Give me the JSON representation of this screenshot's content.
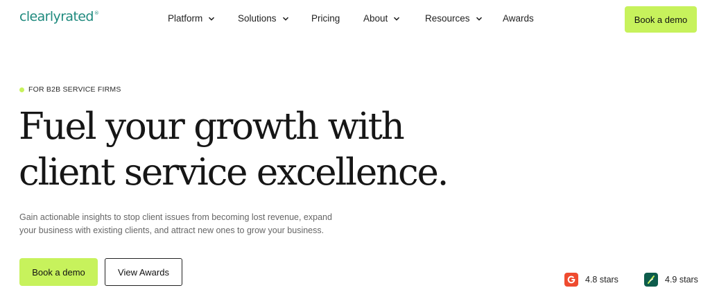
{
  "nav": {
    "logo": {
      "text": "clearlyrated",
      "mark": "®"
    },
    "items": [
      {
        "label": "Platform",
        "has_dropdown": true
      },
      {
        "label": "Solutions",
        "has_dropdown": true
      },
      {
        "label": "Pricing",
        "has_dropdown": false
      },
      {
        "label": "About",
        "has_dropdown": true
      },
      {
        "label": "Resources",
        "has_dropdown": true
      },
      {
        "label": "Awards",
        "has_dropdown": false
      }
    ],
    "cta_label": "Book a demo"
  },
  "hero": {
    "eyebrow": "FOR B2B SERVICE FIRMS",
    "headline_line1": "Fuel your growth with",
    "headline_line2": "client service excellence.",
    "subtext": "Gain actionable insights to stop client issues from becoming lost revenue, expand your business with existing clients, and attract new ones to grow your business.",
    "primary_cta": "Book a demo",
    "secondary_cta": "View Awards"
  },
  "ratings": [
    {
      "icon": "g2-icon",
      "text": "4.8 stars"
    },
    {
      "icon": "capterra-icon",
      "text": "4.9 stars"
    }
  ],
  "colors": {
    "accent": "#c7f25c",
    "logo": "#1f8a7e",
    "g2": "#ef4b2f",
    "capterra": "#0d5c4c"
  }
}
